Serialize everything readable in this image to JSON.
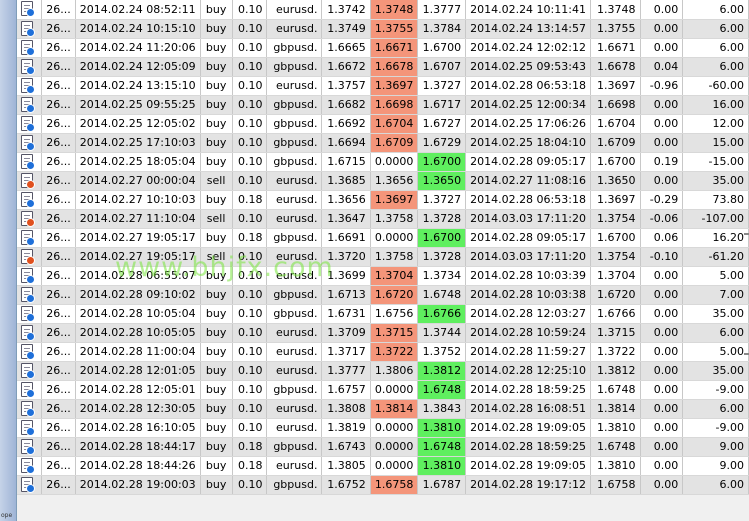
{
  "watermark": "www.bhjfx.com",
  "corner_label": "ope",
  "colors": {
    "loss_highlight": "#f4957a",
    "profit_highlight": "#5fef5f",
    "buy_dot": "#1e6fd9",
    "sell_dot": "#e0501e"
  },
  "orders": [
    {
      "ticket": "26...",
      "open_time": "2014.02.24 08:52:11",
      "type": "buy",
      "size": "0.10",
      "symbol": "eurusd.",
      "price": "1.3742",
      "sl": "1.3748",
      "tp": "1.3777",
      "close_time": "2014.02.24 10:11:41",
      "close_price": "1.3748",
      "swap": "0.00",
      "profit": "6.00",
      "sl_hl": "red",
      "tp_hl": ""
    },
    {
      "ticket": "26...",
      "open_time": "2014.02.24 10:15:10",
      "type": "buy",
      "size": "0.10",
      "symbol": "eurusd.",
      "price": "1.3749",
      "sl": "1.3755",
      "tp": "1.3784",
      "close_time": "2014.02.24 13:14:57",
      "close_price": "1.3755",
      "swap": "0.00",
      "profit": "6.00",
      "sl_hl": "red",
      "tp_hl": ""
    },
    {
      "ticket": "26...",
      "open_time": "2014.02.24 11:20:06",
      "type": "buy",
      "size": "0.10",
      "symbol": "gbpusd.",
      "price": "1.6665",
      "sl": "1.6671",
      "tp": "1.6700",
      "close_time": "2014.02.24 12:02:12",
      "close_price": "1.6671",
      "swap": "0.00",
      "profit": "6.00",
      "sl_hl": "red",
      "tp_hl": ""
    },
    {
      "ticket": "26...",
      "open_time": "2014.02.24 12:05:09",
      "type": "buy",
      "size": "0.10",
      "symbol": "gbpusd.",
      "price": "1.6672",
      "sl": "1.6678",
      "tp": "1.6707",
      "close_time": "2014.02.25 09:53:43",
      "close_price": "1.6678",
      "swap": "0.04",
      "profit": "6.00",
      "sl_hl": "red",
      "tp_hl": ""
    },
    {
      "ticket": "26...",
      "open_time": "2014.02.24 13:15:10",
      "type": "buy",
      "size": "0.10",
      "symbol": "eurusd.",
      "price": "1.3757",
      "sl": "1.3697",
      "tp": "1.3727",
      "close_time": "2014.02.28 06:53:18",
      "close_price": "1.3697",
      "swap": "-0.96",
      "profit": "-60.00",
      "sl_hl": "red",
      "tp_hl": ""
    },
    {
      "ticket": "26...",
      "open_time": "2014.02.25 09:55:25",
      "type": "buy",
      "size": "0.10",
      "symbol": "gbpusd.",
      "price": "1.6682",
      "sl": "1.6698",
      "tp": "1.6717",
      "close_time": "2014.02.25 12:00:34",
      "close_price": "1.6698",
      "swap": "0.00",
      "profit": "16.00",
      "sl_hl": "red",
      "tp_hl": ""
    },
    {
      "ticket": "26...",
      "open_time": "2014.02.25 12:05:02",
      "type": "buy",
      "size": "0.10",
      "symbol": "gbpusd.",
      "price": "1.6692",
      "sl": "1.6704",
      "tp": "1.6727",
      "close_time": "2014.02.25 17:06:26",
      "close_price": "1.6704",
      "swap": "0.00",
      "profit": "12.00",
      "sl_hl": "red",
      "tp_hl": ""
    },
    {
      "ticket": "26...",
      "open_time": "2014.02.25 17:10:03",
      "type": "buy",
      "size": "0.10",
      "symbol": "gbpusd.",
      "price": "1.6694",
      "sl": "1.6709",
      "tp": "1.6729",
      "close_time": "2014.02.25 18:04:10",
      "close_price": "1.6709",
      "swap": "0.00",
      "profit": "15.00",
      "sl_hl": "red",
      "tp_hl": ""
    },
    {
      "ticket": "26...",
      "open_time": "2014.02.25 18:05:04",
      "type": "buy",
      "size": "0.10",
      "symbol": "gbpusd.",
      "price": "1.6715",
      "sl": "0.0000",
      "tp": "1.6700",
      "close_time": "2014.02.28 09:05:17",
      "close_price": "1.6700",
      "swap": "0.19",
      "profit": "-15.00",
      "sl_hl": "",
      "tp_hl": "green"
    },
    {
      "ticket": "26...",
      "open_time": "2014.02.27 00:00:04",
      "type": "sell",
      "size": "0.10",
      "symbol": "eurusd.",
      "price": "1.3685",
      "sl": "1.3656",
      "tp": "1.3650",
      "close_time": "2014.02.27 11:08:16",
      "close_price": "1.3650",
      "swap": "0.00",
      "profit": "35.00",
      "sl_hl": "",
      "tp_hl": "green"
    },
    {
      "ticket": "26...",
      "open_time": "2014.02.27 10:10:03",
      "type": "buy",
      "size": "0.18",
      "symbol": "eurusd.",
      "price": "1.3656",
      "sl": "1.3697",
      "tp": "1.3727",
      "close_time": "2014.02.28 06:53:18",
      "close_price": "1.3697",
      "swap": "-0.29",
      "profit": "73.80",
      "sl_hl": "red",
      "tp_hl": ""
    },
    {
      "ticket": "26...",
      "open_time": "2014.02.27 11:10:04",
      "type": "sell",
      "size": "0.10",
      "symbol": "eurusd.",
      "price": "1.3647",
      "sl": "1.3758",
      "tp": "1.3728",
      "close_time": "2014.03.03 17:11:20",
      "close_price": "1.3754",
      "swap": "-0.06",
      "profit": "-107.00",
      "sl_hl": "",
      "tp_hl": ""
    },
    {
      "ticket": "26...",
      "open_time": "2014.02.27 19:05:17",
      "type": "buy",
      "size": "0.18",
      "symbol": "gbpusd.",
      "price": "1.6691",
      "sl": "0.0000",
      "tp": "1.6700",
      "close_time": "2014.02.28 09:05:17",
      "close_price": "1.6700",
      "swap": "0.06",
      "profit": "16.20",
      "sl_hl": "",
      "tp_hl": "green"
    },
    {
      "ticket": "26...",
      "open_time": "2014.02.27 19:05:17",
      "type": "sell",
      "size": "0.10",
      "symbol": "eurusd.",
      "price": "1.3720",
      "sl": "1.3758",
      "tp": "1.3728",
      "close_time": "2014.03.03 17:11:20",
      "close_price": "1.3754",
      "swap": "-0.10",
      "profit": "-61.20",
      "sl_hl": "",
      "tp_hl": ""
    },
    {
      "ticket": "26...",
      "open_time": "2014.02.28 06:55:07",
      "type": "buy",
      "size": "0.10",
      "symbol": "eurusd.",
      "price": "1.3699",
      "sl": "1.3704",
      "tp": "1.3734",
      "close_time": "2014.02.28 10:03:39",
      "close_price": "1.3704",
      "swap": "0.00",
      "profit": "5.00",
      "sl_hl": "red",
      "tp_hl": ""
    },
    {
      "ticket": "26...",
      "open_time": "2014.02.28 09:10:02",
      "type": "buy",
      "size": "0.10",
      "symbol": "gbpusd.",
      "price": "1.6713",
      "sl": "1.6720",
      "tp": "1.6748",
      "close_time": "2014.02.28 10:03:38",
      "close_price": "1.6720",
      "swap": "0.00",
      "profit": "7.00",
      "sl_hl": "red",
      "tp_hl": ""
    },
    {
      "ticket": "26...",
      "open_time": "2014.02.28 10:05:04",
      "type": "buy",
      "size": "0.10",
      "symbol": "gbpusd.",
      "price": "1.6731",
      "sl": "1.6756",
      "tp": "1.6766",
      "close_time": "2014.02.28 12:03:27",
      "close_price": "1.6766",
      "swap": "0.00",
      "profit": "35.00",
      "sl_hl": "",
      "tp_hl": "green"
    },
    {
      "ticket": "26...",
      "open_time": "2014.02.28 10:05:05",
      "type": "buy",
      "size": "0.10",
      "symbol": "eurusd.",
      "price": "1.3709",
      "sl": "1.3715",
      "tp": "1.3744",
      "close_time": "2014.02.28 10:59:24",
      "close_price": "1.3715",
      "swap": "0.00",
      "profit": "6.00",
      "sl_hl": "red",
      "tp_hl": ""
    },
    {
      "ticket": "26...",
      "open_time": "2014.02.28 11:00:04",
      "type": "buy",
      "size": "0.10",
      "symbol": "eurusd.",
      "price": "1.3717",
      "sl": "1.3722",
      "tp": "1.3752",
      "close_time": "2014.02.28 11:59:27",
      "close_price": "1.3722",
      "swap": "0.00",
      "profit": "5.00",
      "sl_hl": "red",
      "tp_hl": ""
    },
    {
      "ticket": "26...",
      "open_time": "2014.02.28 12:01:05",
      "type": "buy",
      "size": "0.10",
      "symbol": "eurusd.",
      "price": "1.3777",
      "sl": "1.3806",
      "tp": "1.3812",
      "close_time": "2014.02.28 12:25:10",
      "close_price": "1.3812",
      "swap": "0.00",
      "profit": "35.00",
      "sl_hl": "",
      "tp_hl": "green"
    },
    {
      "ticket": "26...",
      "open_time": "2014.02.28 12:05:01",
      "type": "buy",
      "size": "0.10",
      "symbol": "gbpusd.",
      "price": "1.6757",
      "sl": "0.0000",
      "tp": "1.6748",
      "close_time": "2014.02.28 18:59:25",
      "close_price": "1.6748",
      "swap": "0.00",
      "profit": "-9.00",
      "sl_hl": "",
      "tp_hl": "green"
    },
    {
      "ticket": "26...",
      "open_time": "2014.02.28 12:30:05",
      "type": "buy",
      "size": "0.10",
      "symbol": "eurusd.",
      "price": "1.3808",
      "sl": "1.3814",
      "tp": "1.3843",
      "close_time": "2014.02.28 16:08:51",
      "close_price": "1.3814",
      "swap": "0.00",
      "profit": "6.00",
      "sl_hl": "red",
      "tp_hl": ""
    },
    {
      "ticket": "26...",
      "open_time": "2014.02.28 16:10:05",
      "type": "buy",
      "size": "0.10",
      "symbol": "eurusd.",
      "price": "1.3819",
      "sl": "0.0000",
      "tp": "1.3810",
      "close_time": "2014.02.28 19:09:05",
      "close_price": "1.3810",
      "swap": "0.00",
      "profit": "-9.00",
      "sl_hl": "",
      "tp_hl": "green"
    },
    {
      "ticket": "26...",
      "open_time": "2014.02.28 18:44:17",
      "type": "buy",
      "size": "0.18",
      "symbol": "gbpusd.",
      "price": "1.6743",
      "sl": "0.0000",
      "tp": "1.6748",
      "close_time": "2014.02.28 18:59:25",
      "close_price": "1.6748",
      "swap": "0.00",
      "profit": "9.00",
      "sl_hl": "",
      "tp_hl": "green"
    },
    {
      "ticket": "26...",
      "open_time": "2014.02.28 18:44:26",
      "type": "buy",
      "size": "0.18",
      "symbol": "eurusd.",
      "price": "1.3805",
      "sl": "0.0000",
      "tp": "1.3810",
      "close_time": "2014.02.28 19:09:05",
      "close_price": "1.3810",
      "swap": "0.00",
      "profit": "9.00",
      "sl_hl": "",
      "tp_hl": "green"
    },
    {
      "ticket": "26...",
      "open_time": "2014.02.28 19:00:03",
      "type": "buy",
      "size": "0.10",
      "symbol": "gbpusd.",
      "price": "1.6752",
      "sl": "1.6758",
      "tp": "1.6787",
      "close_time": "2014.02.28 19:17:12",
      "close_price": "1.6758",
      "swap": "0.00",
      "profit": "6.00",
      "sl_hl": "red",
      "tp_hl": ""
    }
  ]
}
